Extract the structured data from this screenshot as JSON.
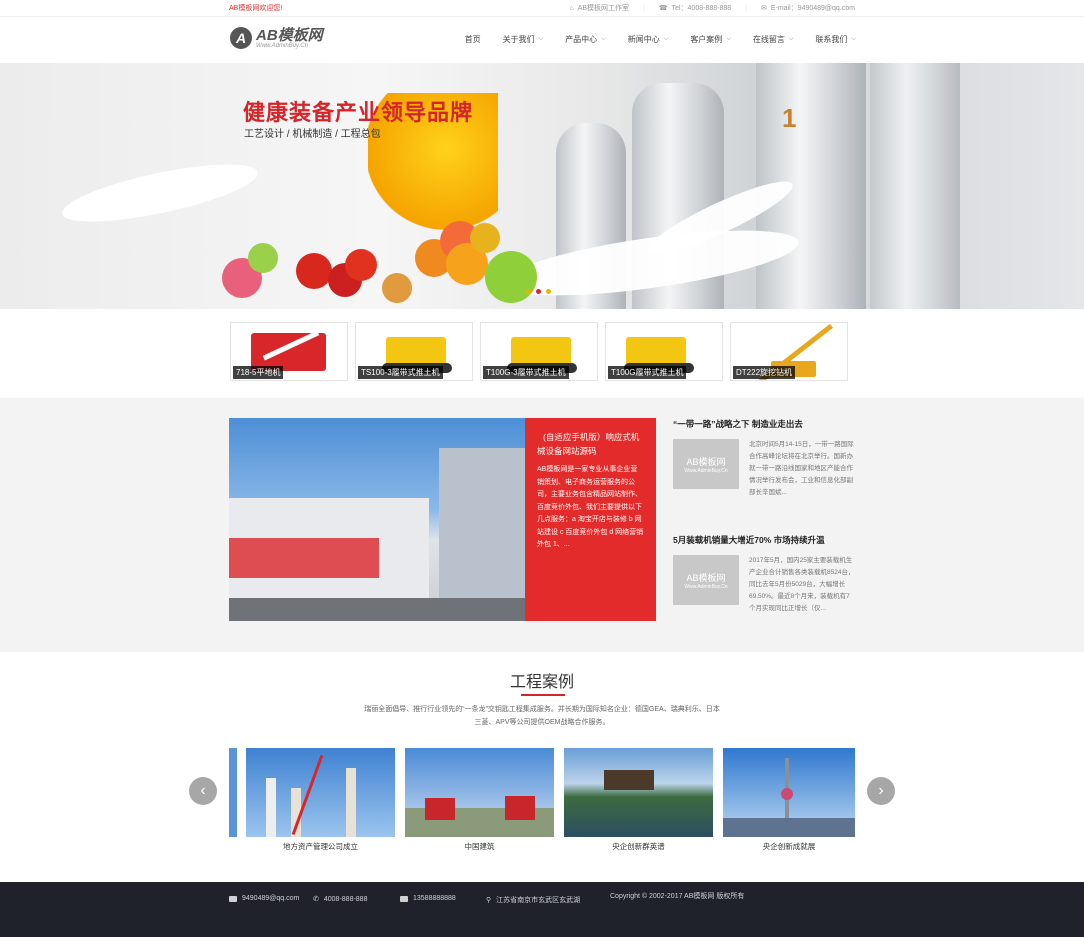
{
  "topbar": {
    "welcome": "AB模板网欢迎您!",
    "studio": "AB模板网工作室",
    "tel": "Tel：4008-888-888",
    "email": "E-mail：9490489@qq.com"
  },
  "logo": {
    "name": "AB模板网",
    "url": "Www.AdminBuy.Cn"
  },
  "nav": [
    {
      "label": "首页"
    },
    {
      "label": "关于我们"
    },
    {
      "label": "产品中心"
    },
    {
      "label": "新闻中心"
    },
    {
      "label": "客户案例"
    },
    {
      "label": "在线留言"
    },
    {
      "label": "联系我们"
    }
  ],
  "banner": {
    "title": "健康装备产业领导品牌",
    "subtitle": "工艺设计 / 机械制造 / 工程总包",
    "tank_label": "1"
  },
  "products": [
    {
      "label": "718-5平地机"
    },
    {
      "label": "TS100-3履带式推土机"
    },
    {
      "label": "T100G-3履带式推土机"
    },
    {
      "label": "T100G履带式推土机"
    },
    {
      "label": "DT222旋挖钻机"
    }
  ],
  "feature": {
    "title": "(自适应手机版）响应式机械设备网站源码",
    "desc": "AB模板网是一家专业从事企业营销策划、电子商务运营服务的公司，主要业务包含精品网站制作、百度竞价外包、我们主要提供以下几点服务：a 淘宝开店与装修 b 网站建设 c 百度竞价外包 d 网络营销外包 1、..."
  },
  "news": [
    {
      "title": "“一带一路”战略之下 制造业走出去",
      "thumb": "AB模板网",
      "thumb_url": "Www.AdminBuy.Cn",
      "desc": "北京时间5月14-15日，一带一路国际合作高峰论坛将在北京举行。国新办就一带一路沿线国家和地区产能合作情况举行发布会，工业和信息化部副部长辛国斌..."
    },
    {
      "title": "5月装载机销量大增近70% 市场持续升温",
      "thumb": "AB模板网",
      "thumb_url": "Www.AdminBuy.Cn",
      "desc": "2017年5月，国内25家主要装载机生产企业合计销售各类装载机8524台，同比去年5月份5029台，大幅增长69.50%。最近8个月来，装载机有7个月实现同比正增长（仅..."
    }
  ],
  "cases": {
    "title": "工程案例",
    "desc": "瑞丽全面倡导、推行行业领先的“一条龙”交钥匙工程集成服务。并长期为国际知名企业：德国GEA、瑞典利乐、日本三菱、APV等公司提供OEM战略合作服务。",
    "prev": "‹",
    "next": "›",
    "items": [
      {
        "label": "地方资产管理公司成立"
      },
      {
        "label": "中国建筑"
      },
      {
        "label": "央企创新群英谱"
      },
      {
        "label": "央企创新成就展"
      }
    ]
  },
  "footer": {
    "email": "9490489@qq.com",
    "tel": "4008-888-888",
    "mobile": "13588888888",
    "address": "江苏省南京市玄武区玄武湖",
    "copyright": "Copyright © 2002-2017 AB模板网 版权所有"
  },
  "colors": {
    "accent": "#e42b2b",
    "footer_bg": "#20222b"
  }
}
